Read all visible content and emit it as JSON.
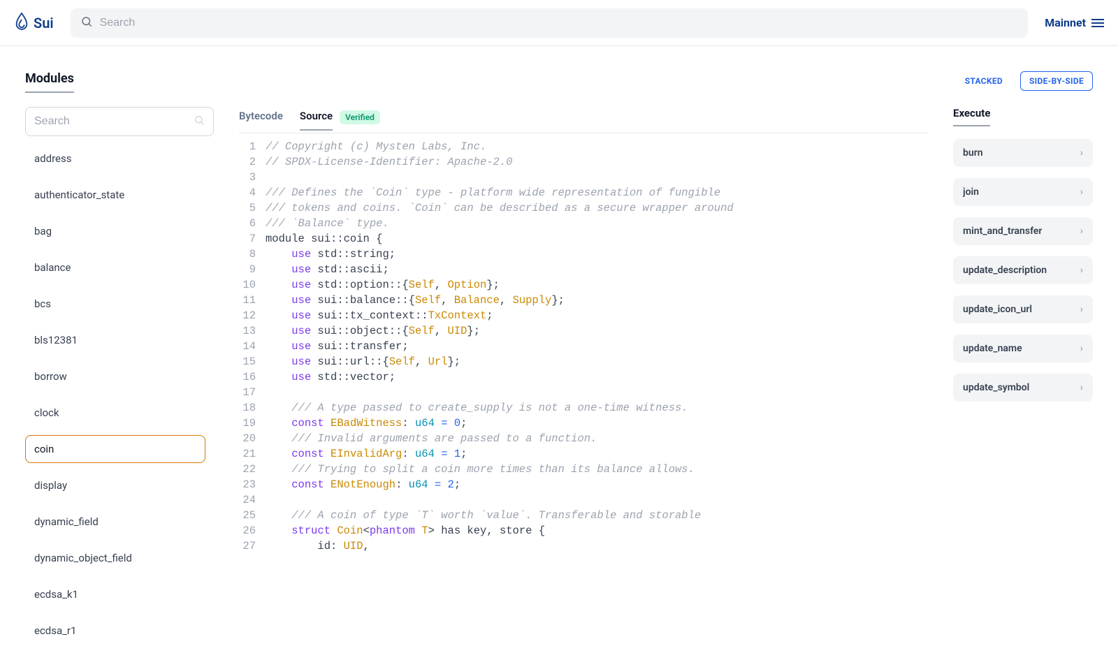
{
  "header": {
    "brand": "Sui",
    "search_placeholder": "Search",
    "network": "Mainnet"
  },
  "section_title": "Modules",
  "layout_options": {
    "stacked": "STACKED",
    "side_by_side": "SIDE-BY-SIDE"
  },
  "module_search_placeholder": "Search",
  "modules": [
    "address",
    "authenticator_state",
    "bag",
    "balance",
    "bcs",
    "bls12381",
    "borrow",
    "clock",
    "coin",
    "display",
    "dynamic_field",
    "dynamic_object_field",
    "ecdsa_k1",
    "ecdsa_r1"
  ],
  "selected_module": "coin",
  "tabs": {
    "bytecode": "Bytecode",
    "source": "Source",
    "verified": "Verified"
  },
  "source_lines": [
    [
      [
        "comment",
        "// Copyright (c) Mysten Labs, Inc."
      ]
    ],
    [
      [
        "comment",
        "// SPDX-License-Identifier: Apache-2.0"
      ]
    ],
    [],
    [
      [
        "comment",
        "/// Defines the `Coin` type - platform wide representation of fungible"
      ]
    ],
    [
      [
        "comment",
        "/// tokens and coins. `Coin` can be described as a secure wrapper around"
      ]
    ],
    [
      [
        "comment",
        "/// `Balance` type."
      ]
    ],
    [
      [
        "plain",
        "module sui::coin {"
      ]
    ],
    [
      [
        "plain",
        "    "
      ],
      [
        "kw",
        "use"
      ],
      [
        "plain",
        " std::string;"
      ]
    ],
    [
      [
        "plain",
        "    "
      ],
      [
        "kw",
        "use"
      ],
      [
        "plain",
        " std::ascii;"
      ]
    ],
    [
      [
        "plain",
        "    "
      ],
      [
        "kw",
        "use"
      ],
      [
        "plain",
        " std::option::{"
      ],
      [
        "type",
        "Self"
      ],
      [
        "plain",
        ", "
      ],
      [
        "type",
        "Option"
      ],
      [
        "plain",
        "};"
      ]
    ],
    [
      [
        "plain",
        "    "
      ],
      [
        "kw",
        "use"
      ],
      [
        "plain",
        " sui::balance::{"
      ],
      [
        "type",
        "Self"
      ],
      [
        "plain",
        ", "
      ],
      [
        "type",
        "Balance"
      ],
      [
        "plain",
        ", "
      ],
      [
        "type",
        "Supply"
      ],
      [
        "plain",
        "};"
      ]
    ],
    [
      [
        "plain",
        "    "
      ],
      [
        "kw",
        "use"
      ],
      [
        "plain",
        " sui::tx_context::"
      ],
      [
        "type",
        "TxContext"
      ],
      [
        "plain",
        ";"
      ]
    ],
    [
      [
        "plain",
        "    "
      ],
      [
        "kw",
        "use"
      ],
      [
        "plain",
        " sui::object::{"
      ],
      [
        "type",
        "Self"
      ],
      [
        "plain",
        ", "
      ],
      [
        "type",
        "UID"
      ],
      [
        "plain",
        "};"
      ]
    ],
    [
      [
        "plain",
        "    "
      ],
      [
        "kw",
        "use"
      ],
      [
        "plain",
        " sui::transfer;"
      ]
    ],
    [
      [
        "plain",
        "    "
      ],
      [
        "kw",
        "use"
      ],
      [
        "plain",
        " sui::url::{"
      ],
      [
        "type",
        "Self"
      ],
      [
        "plain",
        ", "
      ],
      [
        "type",
        "Url"
      ],
      [
        "plain",
        "};"
      ]
    ],
    [
      [
        "plain",
        "    "
      ],
      [
        "kw",
        "use"
      ],
      [
        "plain",
        " std::vector;"
      ]
    ],
    [],
    [
      [
        "plain",
        "    "
      ],
      [
        "comment",
        "/// A type passed to create_supply is not a one-time witness."
      ]
    ],
    [
      [
        "plain",
        "    "
      ],
      [
        "kw",
        "const"
      ],
      [
        "plain",
        " "
      ],
      [
        "type",
        "EBadWitness"
      ],
      [
        "plain",
        ": "
      ],
      [
        "ident",
        "u64"
      ],
      [
        "plain",
        " "
      ],
      [
        "op",
        "="
      ],
      [
        "plain",
        " "
      ],
      [
        "num",
        "0"
      ],
      [
        "plain",
        ";"
      ]
    ],
    [
      [
        "plain",
        "    "
      ],
      [
        "comment",
        "/// Invalid arguments are passed to a function."
      ]
    ],
    [
      [
        "plain",
        "    "
      ],
      [
        "kw",
        "const"
      ],
      [
        "plain",
        " "
      ],
      [
        "type",
        "EInvalidArg"
      ],
      [
        "plain",
        ": "
      ],
      [
        "ident",
        "u64"
      ],
      [
        "plain",
        " "
      ],
      [
        "op",
        "="
      ],
      [
        "plain",
        " "
      ],
      [
        "num",
        "1"
      ],
      [
        "plain",
        ";"
      ]
    ],
    [
      [
        "plain",
        "    "
      ],
      [
        "comment",
        "/// Trying to split a coin more times than its balance allows."
      ]
    ],
    [
      [
        "plain",
        "    "
      ],
      [
        "kw",
        "const"
      ],
      [
        "plain",
        " "
      ],
      [
        "type",
        "ENotEnough"
      ],
      [
        "plain",
        ": "
      ],
      [
        "ident",
        "u64"
      ],
      [
        "plain",
        " "
      ],
      [
        "op",
        "="
      ],
      [
        "plain",
        " "
      ],
      [
        "num",
        "2"
      ],
      [
        "plain",
        ";"
      ]
    ],
    [],
    [
      [
        "plain",
        "    "
      ],
      [
        "comment",
        "/// A coin of type `T` worth `value`. Transferable and storable"
      ]
    ],
    [
      [
        "plain",
        "    "
      ],
      [
        "kw",
        "struct"
      ],
      [
        "plain",
        " "
      ],
      [
        "type",
        "Coin"
      ],
      [
        "plain",
        "<"
      ],
      [
        "kw",
        "phantom"
      ],
      [
        "plain",
        " "
      ],
      [
        "type",
        "T"
      ],
      [
        "plain",
        "> has key, store {"
      ]
    ],
    [
      [
        "plain",
        "        id: "
      ],
      [
        "type",
        "UID"
      ],
      [
        "plain",
        ","
      ]
    ]
  ],
  "execute_title": "Execute",
  "execute_items": [
    "burn",
    "join",
    "mint_and_transfer",
    "update_description",
    "update_icon_url",
    "update_name",
    "update_symbol"
  ]
}
